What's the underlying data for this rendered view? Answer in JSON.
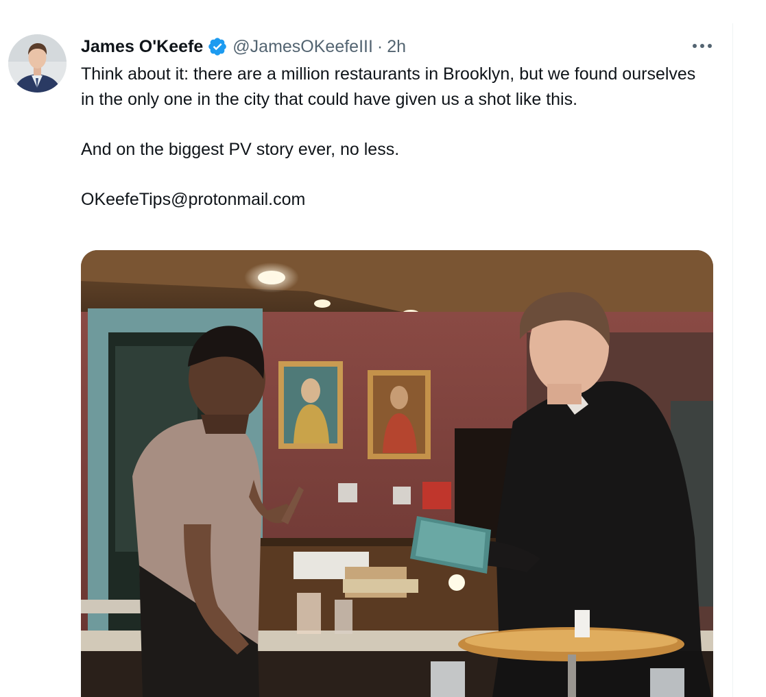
{
  "tweet": {
    "author": {
      "name": "James O'Keefe",
      "handle": "@JamesOKeefeIII",
      "separator": "·",
      "time": "2h"
    },
    "text": {
      "line1": "Think about it: there are a million restaurants in Brooklyn, but we found ourselves in the only one in the city that could have given us a shot like this.",
      "line2": "And on the biggest PV story ever, no less.",
      "line3": "OKeefeTips@protonmail.com"
    },
    "icons": {
      "verified": "verified-badge-icon",
      "more": "more-options-icon"
    },
    "colors": {
      "verified": "#1d9bf0",
      "secondary_text": "#536471",
      "primary_text": "#0f1419"
    }
  }
}
